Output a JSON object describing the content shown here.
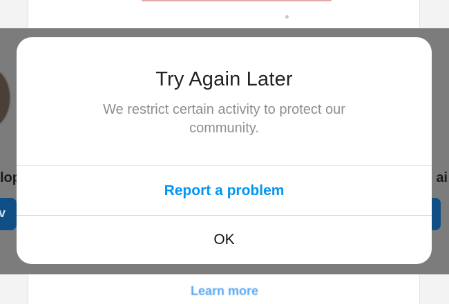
{
  "background": {
    "left_user_name_fragment": "lop",
    "right_user_name_fragment": "ai",
    "left_button_fragment": "v",
    "learn_more_link": "Learn more"
  },
  "dialog": {
    "title": "Try Again Later",
    "message": "We restrict certain activity to protect our community.",
    "report_button": "Report a problem",
    "ok_button": "OK"
  },
  "colors": {
    "primary_action": "#0095f6",
    "secondary_text": "#8e8e8e",
    "title_text": "#222222",
    "divider": "#dbdbdb"
  }
}
